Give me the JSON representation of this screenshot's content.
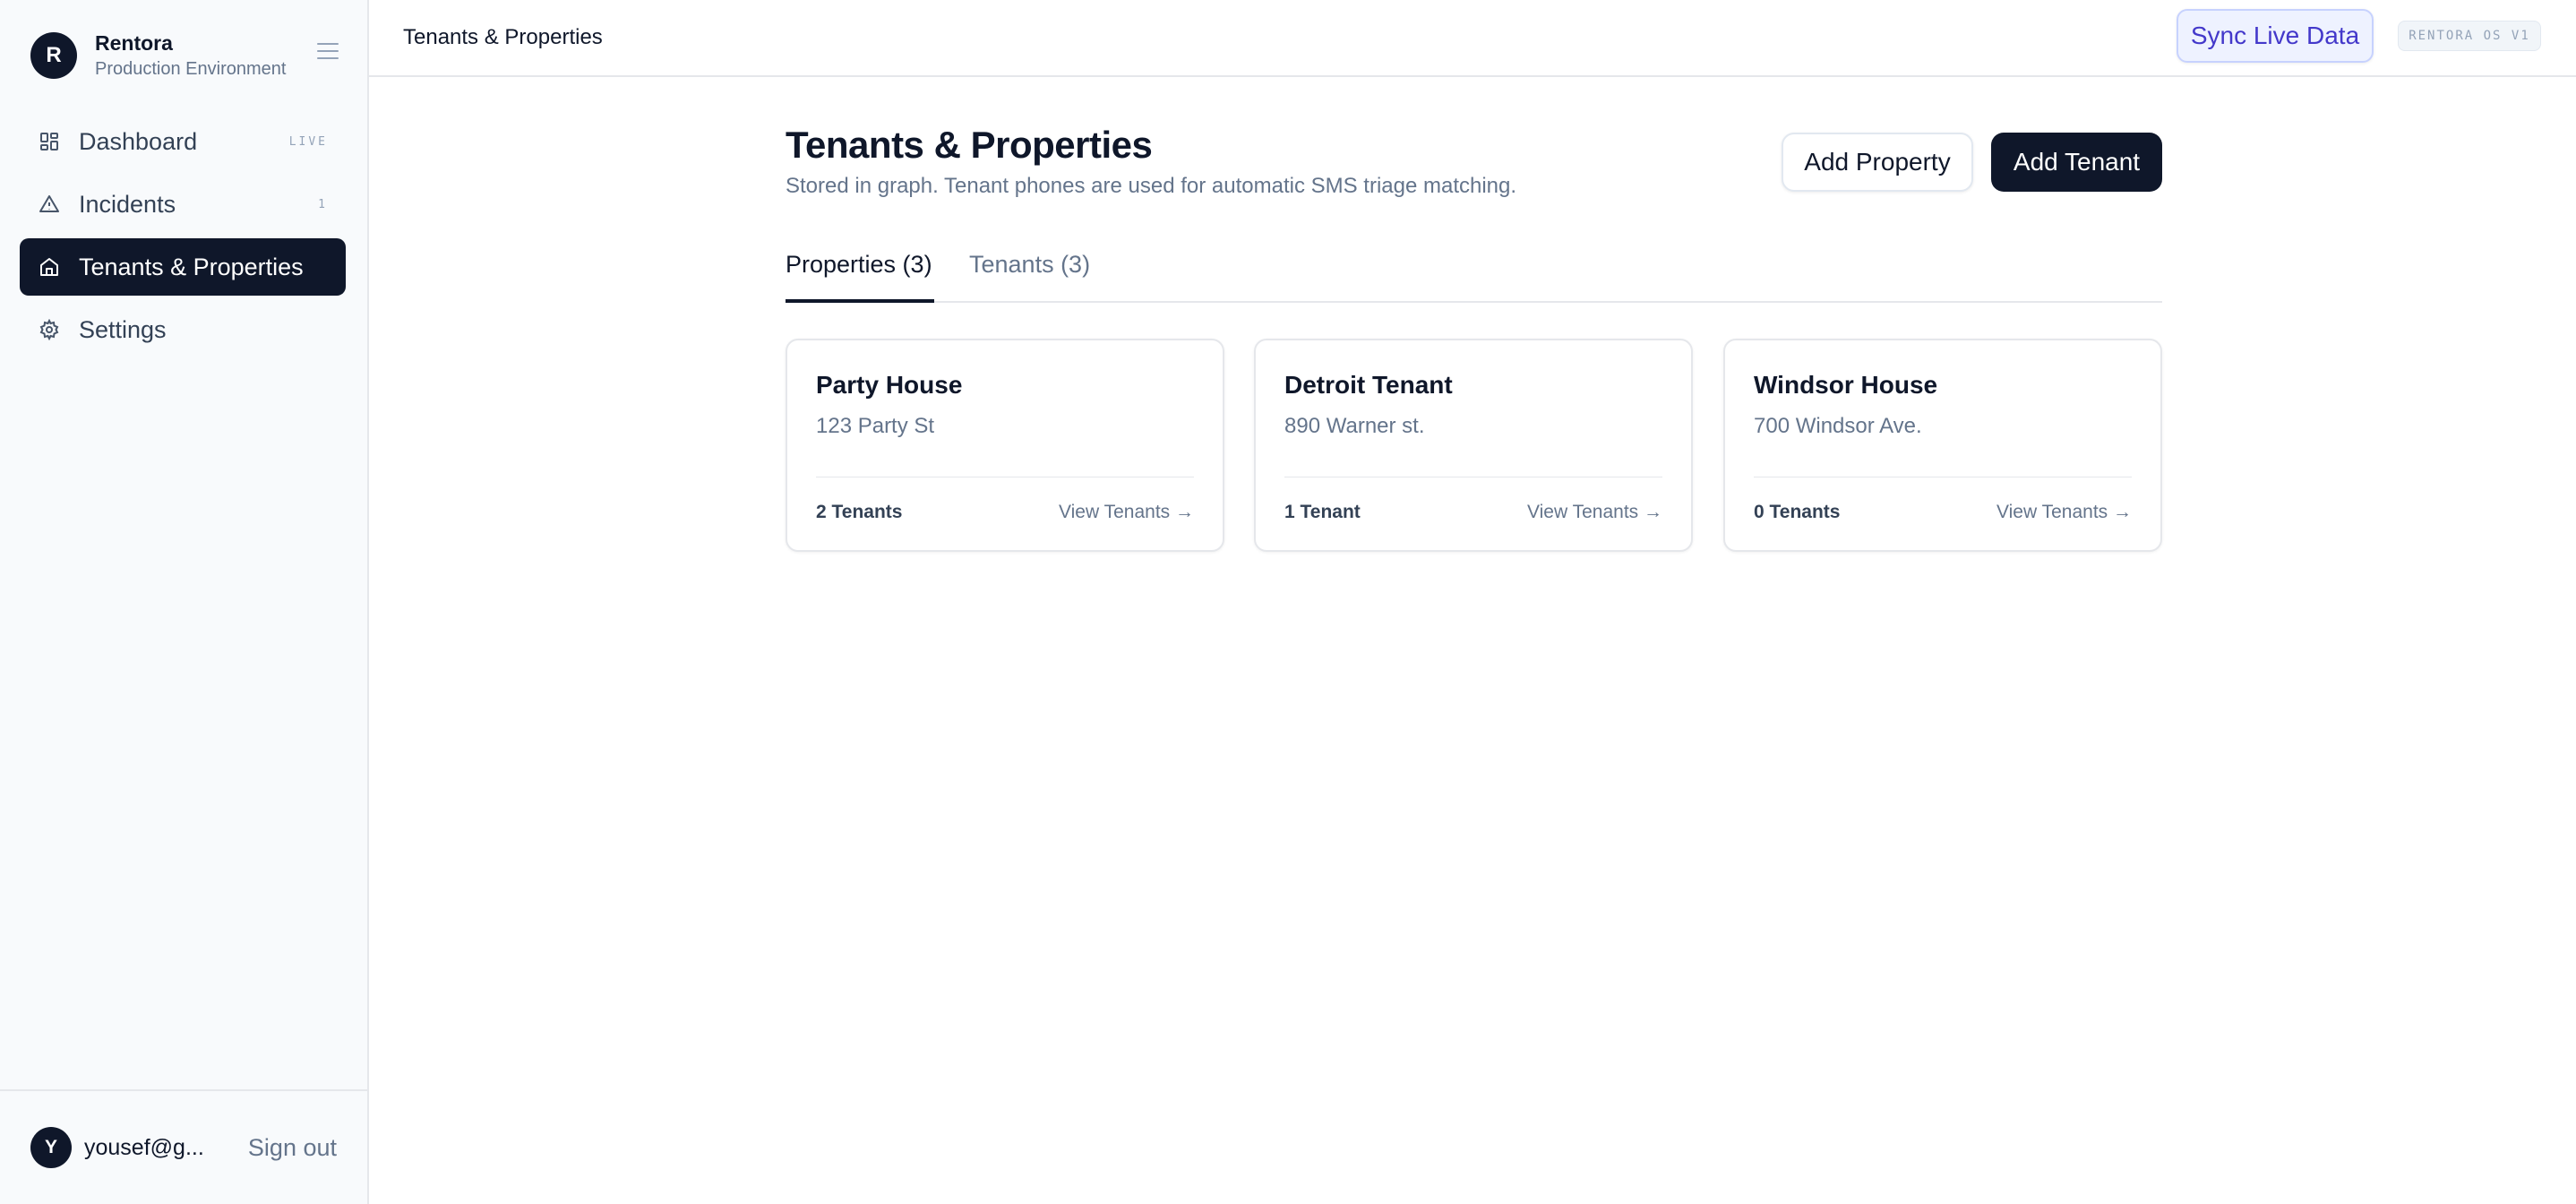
{
  "brand": {
    "initial": "R",
    "name": "Rentora",
    "environment": "Production Environment"
  },
  "sidebar": {
    "items": [
      {
        "label": "Dashboard",
        "icon": "dashboard-grid-icon",
        "meta": "LIVE",
        "active": false
      },
      {
        "label": "Incidents",
        "icon": "warning-triangle-icon",
        "meta": "1",
        "active": false
      },
      {
        "label": "Tenants & Properties",
        "icon": "home-icon",
        "meta": "",
        "active": true
      },
      {
        "label": "Settings",
        "icon": "gear-icon",
        "meta": "",
        "active": false
      }
    ]
  },
  "user": {
    "initial": "Y",
    "email": "yousef@g...",
    "signout_label": "Sign out"
  },
  "topbar": {
    "title": "Tenants & Properties",
    "sync_label": "Sync Live Data",
    "version": "RENTORA OS V1"
  },
  "page": {
    "title": "Tenants & Properties",
    "subtitle": "Stored in graph. Tenant phones are used for automatic SMS triage matching.",
    "add_property_label": "Add Property",
    "add_tenant_label": "Add Tenant"
  },
  "tabs": [
    {
      "label": "Properties (3)",
      "active": true
    },
    {
      "label": "Tenants (3)",
      "active": false
    }
  ],
  "properties": [
    {
      "name": "Party House",
      "address": "123 Party St",
      "tenants": "2 Tenants",
      "link": "View Tenants →"
    },
    {
      "name": "Detroit Tenant",
      "address": "890 Warner st.",
      "tenants": "1 Tenant",
      "link": "View Tenants →"
    },
    {
      "name": "Windsor House",
      "address": "700 Windsor Ave.",
      "tenants": "0 Tenants",
      "link": "View Tenants →"
    }
  ],
  "colors": {
    "primary": "#0f172a",
    "accent": "#4338ca",
    "accent_bg": "#eef2ff",
    "muted": "#64748b",
    "sidebar_bg": "#f8fafc"
  }
}
